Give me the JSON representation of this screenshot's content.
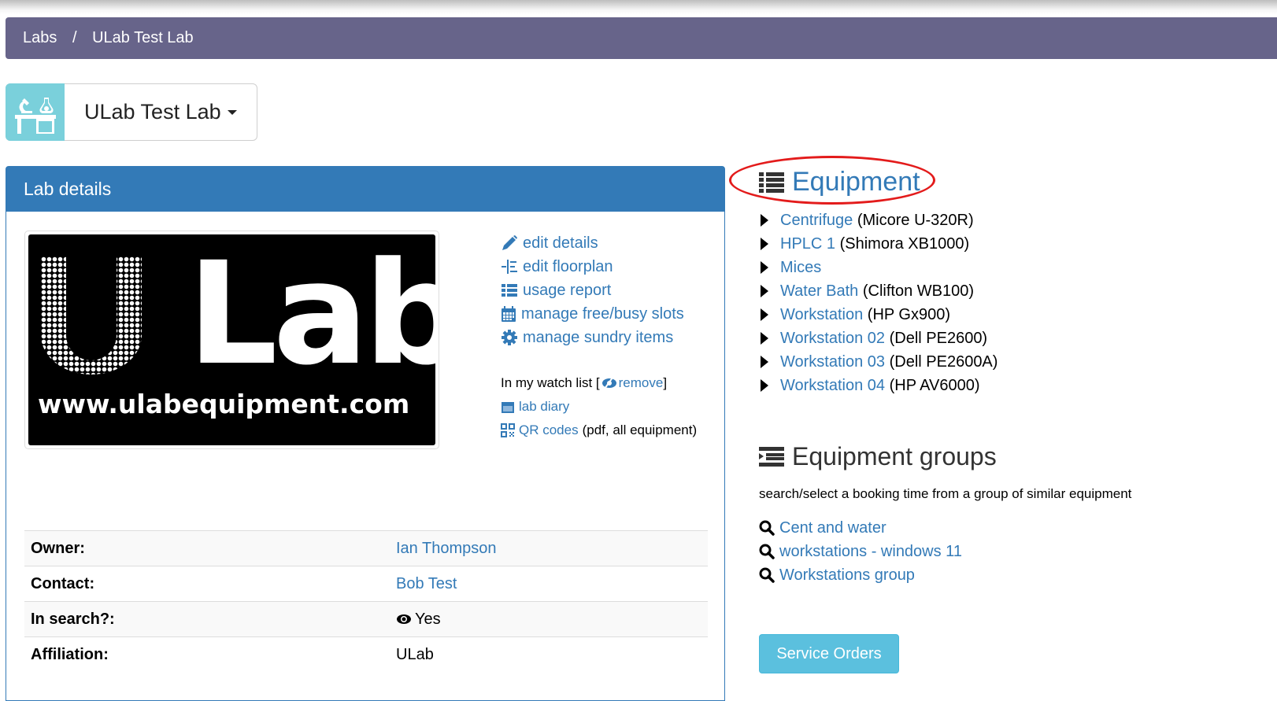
{
  "breadcrumb": {
    "items": [
      "Labs",
      "ULab Test Lab"
    ],
    "separator": "/"
  },
  "lab_selector": {
    "name": "ULab Test Lab"
  },
  "panel": {
    "title": "Lab details",
    "logo": {
      "big_text": "Lab",
      "letter": "U",
      "url_text": "www.ulabequipment.com"
    },
    "actions": [
      {
        "icon": "pencil-icon",
        "label": "edit details"
      },
      {
        "icon": "floorplan-icon",
        "label": "edit floorplan"
      },
      {
        "icon": "list-icon",
        "label": "usage report"
      },
      {
        "icon": "calendar-icon",
        "label": "manage free/busy slots"
      },
      {
        "icon": "gear-icon",
        "label": "manage sundry items"
      }
    ],
    "watch": {
      "prefix": "In my watch list [",
      "remove_label": "remove",
      "suffix": "]",
      "diary_label": "lab diary",
      "qr_label": "QR codes",
      "qr_suffix": "(pdf, all equipment)"
    },
    "details": [
      {
        "label": "Owner:",
        "value": "Ian Thompson",
        "link": true
      },
      {
        "label": "Contact:",
        "value": "Bob Test",
        "link": true
      },
      {
        "label": "In search?:",
        "value": "Yes",
        "link": false,
        "icon": "eye-icon"
      },
      {
        "label": "Affiliation:",
        "value": "ULab",
        "link": false
      }
    ]
  },
  "equipment": {
    "title": "Equipment",
    "items": [
      {
        "name": "Centrifuge",
        "model": "(Micore U-320R)"
      },
      {
        "name": "HPLC 1",
        "model": "(Shimora XB1000)"
      },
      {
        "name": "Mices",
        "model": ""
      },
      {
        "name": "Water Bath",
        "model": "(Clifton WB100)"
      },
      {
        "name": "Workstation",
        "model": "(HP Gx900)"
      },
      {
        "name": "Workstation 02",
        "model": "(Dell PE2600)"
      },
      {
        "name": "Workstation 03",
        "model": "(Dell PE2600A)"
      },
      {
        "name": "Workstation 04",
        "model": "(HP AV6000)"
      }
    ]
  },
  "groups": {
    "title": "Equipment groups",
    "description": "search/select a booking time from a group of similar equipment",
    "items": [
      "Cent and water",
      "workstations - windows 11",
      "Workstations group"
    ]
  },
  "service_orders": {
    "label": "Service Orders"
  },
  "colors": {
    "breadcrumb_bg": "#67648a",
    "primary": "#337ab7",
    "info": "#5bc0de",
    "lab_icon_bg": "#7ad0db",
    "annotation": "#e31b1b"
  }
}
